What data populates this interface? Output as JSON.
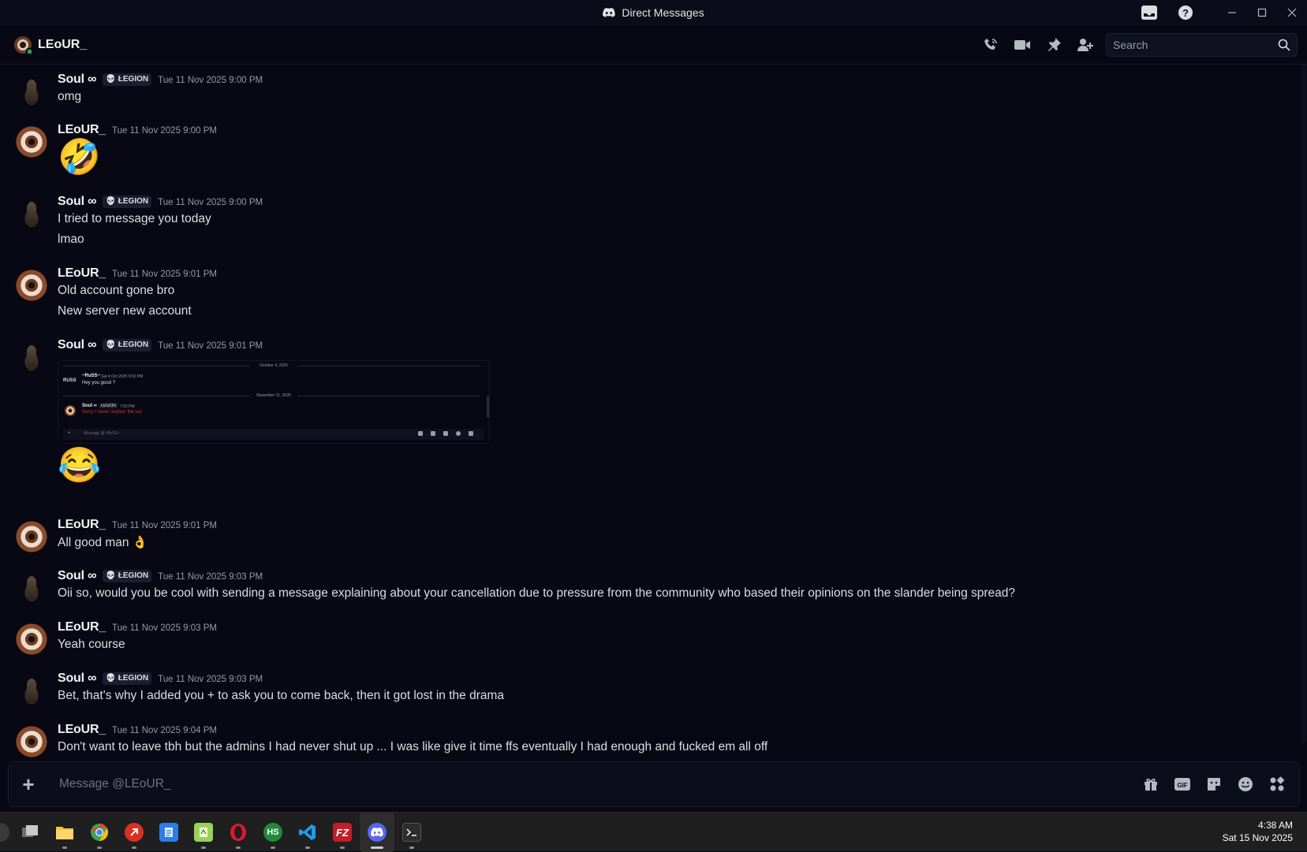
{
  "window": {
    "title": "Direct Messages"
  },
  "header": {
    "username": "LEoUR_",
    "search_placeholder": "Search"
  },
  "messages": [
    {
      "author": "Soul ∞",
      "tag": "ŁEGION",
      "time": "Tue 11 Nov 2025 9:00 PM",
      "lines": [
        "omg"
      ]
    },
    {
      "author": "LEoUR_",
      "time": "Tue 11 Nov 2025 9:00 PM",
      "emoji": "🤣"
    },
    {
      "author": "Soul ∞",
      "tag": "ŁEGION",
      "time": "Tue 11 Nov 2025 9:00 PM",
      "lines": [
        "I tried to message you today",
        "lmao"
      ]
    },
    {
      "author": "LEoUR_",
      "time": "Tue 11 Nov 2025 9:01 PM",
      "lines": [
        "Old account gone bro",
        "New server new account"
      ]
    },
    {
      "author": "Soul ∞",
      "tag": "ŁEGION",
      "time": "Tue 11 Nov 2025 9:01 PM",
      "emoji": "😂",
      "attachment": {
        "date1": "October 4, 2025",
        "r_author": "~RuSS~",
        "r_label": "RUSS",
        "r_time": "Sat 4 Oct 2025 9:52 PM",
        "r_text": "Hey you good ?",
        "date2": "November 11, 2025",
        "s_author": "Soul ∞",
        "s_tag": "ŁEGION",
        "s_time": "7:55 PM",
        "s_text": "Sorry I never replied, flat out",
        "placeholder": "Message @~RuSS~"
      }
    },
    {
      "author": "LEoUR_",
      "time": "Tue 11 Nov 2025 9:01 PM",
      "lines": [
        "All good man 👌"
      ]
    },
    {
      "author": "Soul ∞",
      "tag": "ŁEGION",
      "time": "Tue 11 Nov 2025 9:03 PM",
      "lines": [
        "Oii so, would you be cool with sending a message explaining about your cancellation due to pressure from the community who based their opinions on the slander being spread?"
      ]
    },
    {
      "author": "LEoUR_",
      "time": "Tue 11 Nov 2025 9:03 PM",
      "lines": [
        "Yeah course"
      ]
    },
    {
      "author": "Soul ∞",
      "tag": "ŁEGION",
      "time": "Tue 11 Nov 2025 9:03 PM",
      "lines": [
        "Bet, that's why I added you + to ask you to come back, then it got lost in the drama"
      ]
    },
    {
      "author": "LEoUR_",
      "time": "Tue 11 Nov 2025 9:04 PM",
      "lines": [
        "Don't want to leave tbh but the admins I had never shut up ... I was like give it time ffs eventually I had enough and fucked em all off"
      ]
    }
  ],
  "composer": {
    "placeholder": "Message @LEoUR_",
    "gif_label": "GIF"
  },
  "taskbar": {
    "apps": [
      "task-view",
      "file-explorer",
      "chrome",
      "git-tool",
      "notepad",
      "notepad-plus-plus",
      "opera",
      "hs-app",
      "vscode",
      "filezilla",
      "discord",
      "terminal"
    ],
    "hs_label": "HS",
    "fz_label": "FZ",
    "time": "4:38 AM",
    "date": "Sat 15 Nov 2025"
  },
  "colors": {
    "background": "#070814",
    "online": "#23a55a",
    "accent_red": "#d93025"
  }
}
